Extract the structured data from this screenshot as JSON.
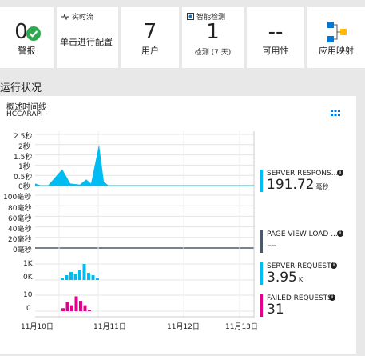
{
  "tiles": {
    "alerts": {
      "value": "0",
      "label": "警报"
    },
    "live_stream": {
      "header": "实时流",
      "label": "单击进行配置"
    },
    "users": {
      "value": "7",
      "label": "用户"
    },
    "smart_detection": {
      "header": "智能检测",
      "value": "1",
      "label": "检测 (7 天)"
    },
    "availability": {
      "value": "--",
      "label": "可用性"
    },
    "app_map": {
      "label": "应用映射"
    }
  },
  "section_title": "运行状况",
  "panel": {
    "title": "概述时间线",
    "subtitle": "HCCARAPI",
    "y_ticks_response": [
      "2.5秒",
      "2秒",
      "1.5秒",
      "1秒",
      "0.5秒",
      "0秒"
    ],
    "y_ticks_pageload": [
      "100毫秒",
      "80毫秒",
      "60毫秒",
      "40毫秒",
      "20毫秒",
      "0毫秒"
    ],
    "y_ticks_requests": [
      "1K",
      "0K"
    ],
    "y_ticks_failed": [
      "10",
      "0"
    ],
    "x_ticks": [
      "11月10日",
      "11月11日",
      "11月12日",
      "11月13日"
    ]
  },
  "metrics": [
    {
      "name": "SERVER RESPONS...",
      "value": "191.72",
      "unit": "毫秒",
      "color": "#00bcf2"
    },
    {
      "name": "PAGE VIEW LOAD ...",
      "value": "--",
      "unit": "",
      "color": "#4a5a6a"
    },
    {
      "name": "SERVER REQUESTS",
      "value": "3.95",
      "unit": "K",
      "color": "#00bcf2"
    },
    {
      "name": "FAILED REQUESTS",
      "value": "31",
      "unit": "",
      "color": "#e3008c"
    }
  ],
  "chart_data": [
    {
      "type": "area",
      "title": "",
      "series": [
        {
          "name": "SERVER RESPONSE TIME",
          "x": [
            "11/10 00:00",
            "11/10 03:00",
            "11/10 06:00",
            "11/10 09:00",
            "11/10 12:00",
            "11/10 15:00",
            "11/10 18:00",
            "11/10 21:00",
            "11/11 00:00",
            "11/11 03:00",
            "11/11 06:00"
          ],
          "values": [
            0.1,
            0.0,
            0.0,
            0.8,
            0.1,
            0.05,
            0.3,
            0.1,
            2.0,
            0.2,
            0.0
          ]
        }
      ],
      "ylim": [
        0,
        2.5
      ],
      "unit": "秒"
    },
    {
      "type": "bar",
      "title": "",
      "series": [
        {
          "name": "SERVER REQUESTS",
          "values": [
            0.1,
            0.3,
            0.5,
            0.4,
            0.6,
            1.0,
            0.45,
            0.3,
            0.1
          ]
        }
      ],
      "ylim": [
        0,
        1.3
      ],
      "unit": "K"
    },
    {
      "type": "bar",
      "title": "",
      "series": [
        {
          "name": "FAILED REQUESTS",
          "values": [
            2,
            6,
            4,
            10,
            7,
            4,
            1
          ]
        }
      ],
      "ylim": [
        0,
        13
      ]
    }
  ],
  "colors": {
    "accent": "#00bcf2",
    "failed": "#e3008c",
    "ok": "#2fa84f"
  }
}
